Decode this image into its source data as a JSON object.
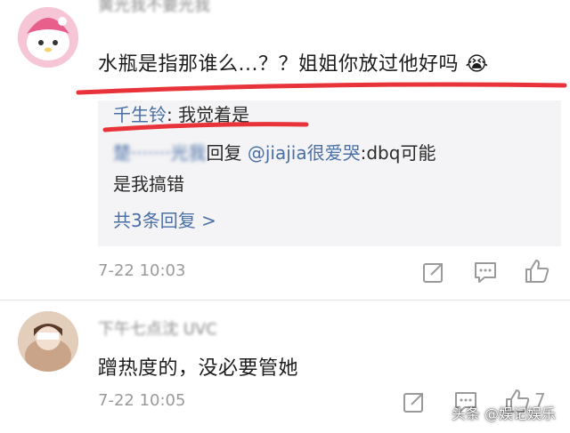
{
  "comments": [
    {
      "username": "黄光我不要光我",
      "text": "水瓶是指那谁么...？？姐姐你放过他好吗",
      "emoji": "😭",
      "time": "7-22 10:03",
      "replies": [
        {
          "name": "千生铃",
          "text": ": 我觉着是"
        },
        {
          "name": "楚·······光我",
          "text": "回复 ",
          "mention": "@jiajia很爱哭",
          "text2": ":dbq可能"
        },
        {
          "text": "是我搞错"
        }
      ],
      "more_replies": "共3条回复 >"
    },
    {
      "username": "下午七点沈 UVC",
      "text": "蹭热度的，没必要管她",
      "time": "7-22 10:05",
      "like_count": "7"
    }
  ],
  "watermark": "头条 @娱记娱乐",
  "colors": {
    "annotation_red": "#e8333a",
    "link_blue": "#4a6fa5"
  },
  "icons": [
    "forward-icon",
    "comment-icon",
    "thumbs-up-icon"
  ]
}
